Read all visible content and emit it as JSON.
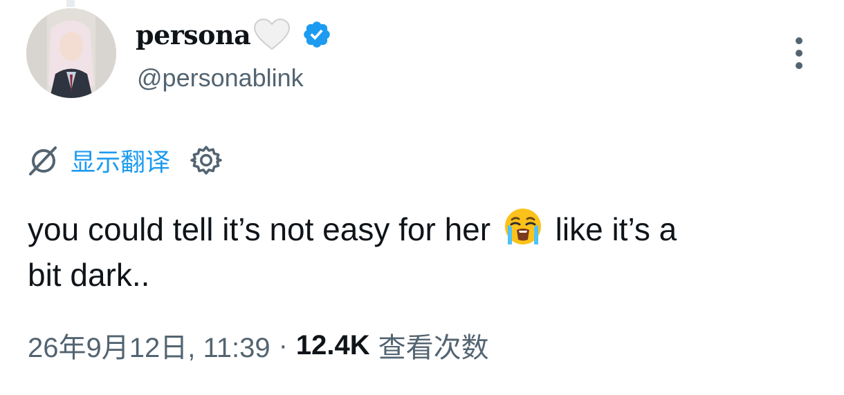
{
  "author": {
    "display_name": "persona",
    "handle": "@personablink",
    "name_emoji": "white-heart-icon",
    "verified_icon": "verified-badge-icon"
  },
  "translate": {
    "icon": "globe-icon",
    "label": "显示翻译",
    "settings_icon": "gear-icon"
  },
  "tweet": {
    "text_before_emoji": "you could tell it’s not easy for her",
    "emoji": "loudly-crying-face-icon",
    "text_after_emoji": "like it’s a",
    "text_line2": "bit dark.."
  },
  "meta": {
    "timestamp": "26年9月12日, 11:39",
    "separator": "·",
    "view_count": "12.4K",
    "view_label": "查看次数"
  },
  "colors": {
    "accent": "#1d9bf0",
    "text_primary": "#0f1419",
    "text_secondary": "#536471",
    "verified": "#1d9bf0"
  }
}
